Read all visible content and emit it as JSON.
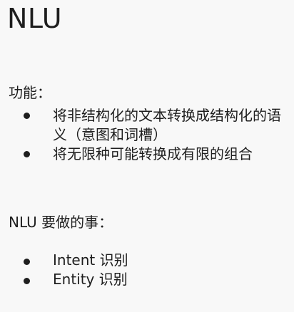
{
  "slide": {
    "title": "NLU",
    "sections": [
      {
        "heading": "功能：",
        "bullets": [
          "将非结构化的文本转换成结构化的语义（意图和词槽）",
          "将无限种可能转换成有限的组合"
        ]
      },
      {
        "heading": "NLU 要做的事：",
        "bullets": [
          "Intent 识别",
          "Entity 识别"
        ]
      }
    ]
  }
}
